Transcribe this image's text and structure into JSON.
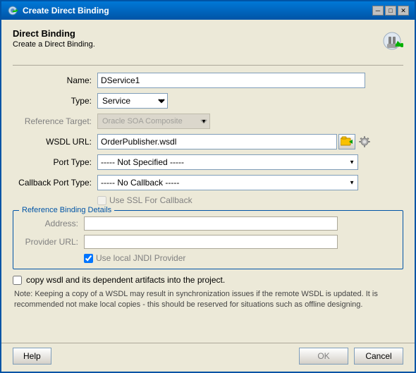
{
  "window": {
    "title": "Create Direct Binding",
    "close_label": "✕",
    "minimize_label": "─",
    "maximize_label": "□"
  },
  "header": {
    "title": "Direct Binding",
    "subtitle": "Create a Direct Binding."
  },
  "form": {
    "name_label": "Name:",
    "name_value": "DService1",
    "type_label": "Type:",
    "type_value": "Service",
    "type_options": [
      "Service"
    ],
    "ref_target_label": "Reference Target:",
    "ref_target_value": "Oracle SOA Composite",
    "wsdl_label": "WSDL URL:",
    "wsdl_value": "OrderPublisher.wsdl",
    "port_type_label": "Port Type:",
    "port_type_value": "----- Not Specified -----",
    "callback_port_label": "Callback Port Type:",
    "callback_port_value": "----- No Callback -----",
    "use_ssl_label": "Use SSL For Callback",
    "ref_binding_title": "Reference Binding Details",
    "address_label": "Address:",
    "address_value": "",
    "provider_url_label": "Provider URL:",
    "provider_url_value": "",
    "use_jndi_label": "Use local JNDI Provider",
    "copy_wsdl_label": "copy wsdl and its dependent artifacts into the project.",
    "note_text": "Note: Keeping a copy of a WSDL may result in synchronization issues if the remote WSDL is updated. It is recommended not make local copies - this should be reserved for situations such as offline designing."
  },
  "footer": {
    "help_label": "Help",
    "ok_label": "OK",
    "cancel_label": "Cancel"
  }
}
